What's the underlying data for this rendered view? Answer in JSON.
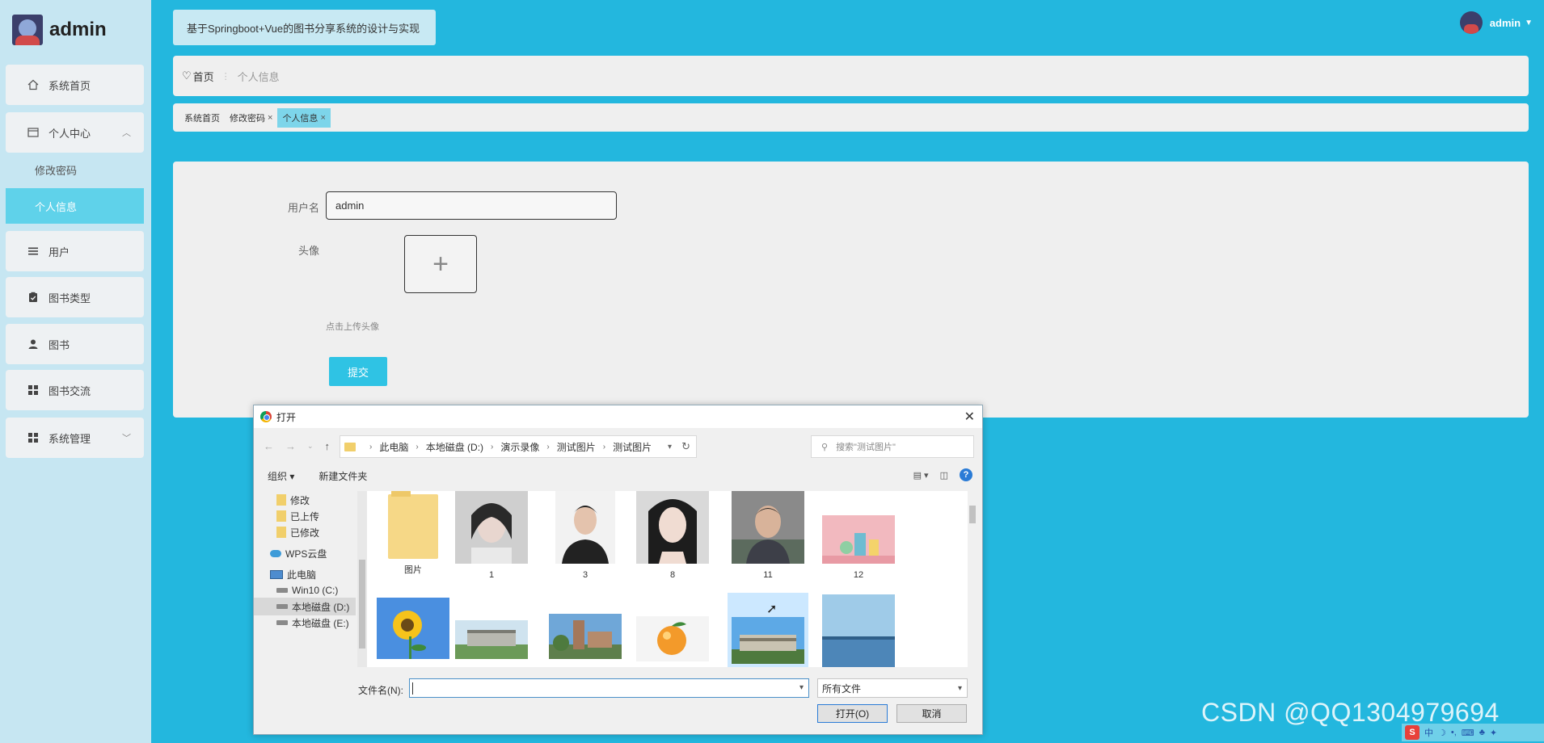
{
  "brand": {
    "name": "admin"
  },
  "header": {
    "app_title": "基于Springboot+Vue的图书分享系统的设计与实现",
    "username": "admin"
  },
  "sidebar": {
    "items": [
      {
        "label": "系统首页",
        "icon": "home-icon"
      },
      {
        "label": "个人中心",
        "icon": "profile-card-icon"
      },
      {
        "label": "用户",
        "icon": "list-icon"
      },
      {
        "label": "图书类型",
        "icon": "clipboard-icon"
      },
      {
        "label": "图书",
        "icon": "person-icon"
      },
      {
        "label": "图书交流",
        "icon": "grid-icon"
      },
      {
        "label": "系统管理",
        "icon": "grid-icon"
      }
    ],
    "submenu": [
      {
        "label": "修改密码"
      },
      {
        "label": "个人信息"
      }
    ]
  },
  "breadcrumb": {
    "home": "首页",
    "current": "个人信息"
  },
  "tags": [
    {
      "label": "系统首页"
    },
    {
      "label": "修改密码"
    },
    {
      "label": "个人信息"
    }
  ],
  "form": {
    "username_label": "用户名",
    "username_value": "admin",
    "avatar_label": "头像",
    "upload_tip": "点击上传头像",
    "submit_label": "提交"
  },
  "dialog": {
    "title": "打开",
    "path": [
      "此电脑",
      "本地磁盘 (D:)",
      "演示录像",
      "测试图片",
      "测试图片"
    ],
    "search_placeholder": "搜索\"测试图片\"",
    "organize_label": "组织 ▾",
    "new_folder_label": "新建文件夹",
    "nav_items": [
      "修改",
      "已上传",
      "已修改",
      "WPS云盘",
      "此电脑",
      "Win10 (C:)",
      "本地磁盘 (D:)",
      "本地磁盘 (E:)"
    ],
    "files": [
      "图片",
      "1",
      "3",
      "8",
      "11",
      "12"
    ],
    "filename_label": "文件名(N):",
    "filename_value": "",
    "filetype": "所有文件",
    "open_label": "打开(O)",
    "cancel_label": "取消"
  },
  "watermark": "CSDN @QQ1304979694",
  "colors": {
    "accent": "#23b7de",
    "active_tab": "#7dd5ea",
    "active_menu": "#5fd2ea",
    "submit": "#2fc3e4"
  }
}
